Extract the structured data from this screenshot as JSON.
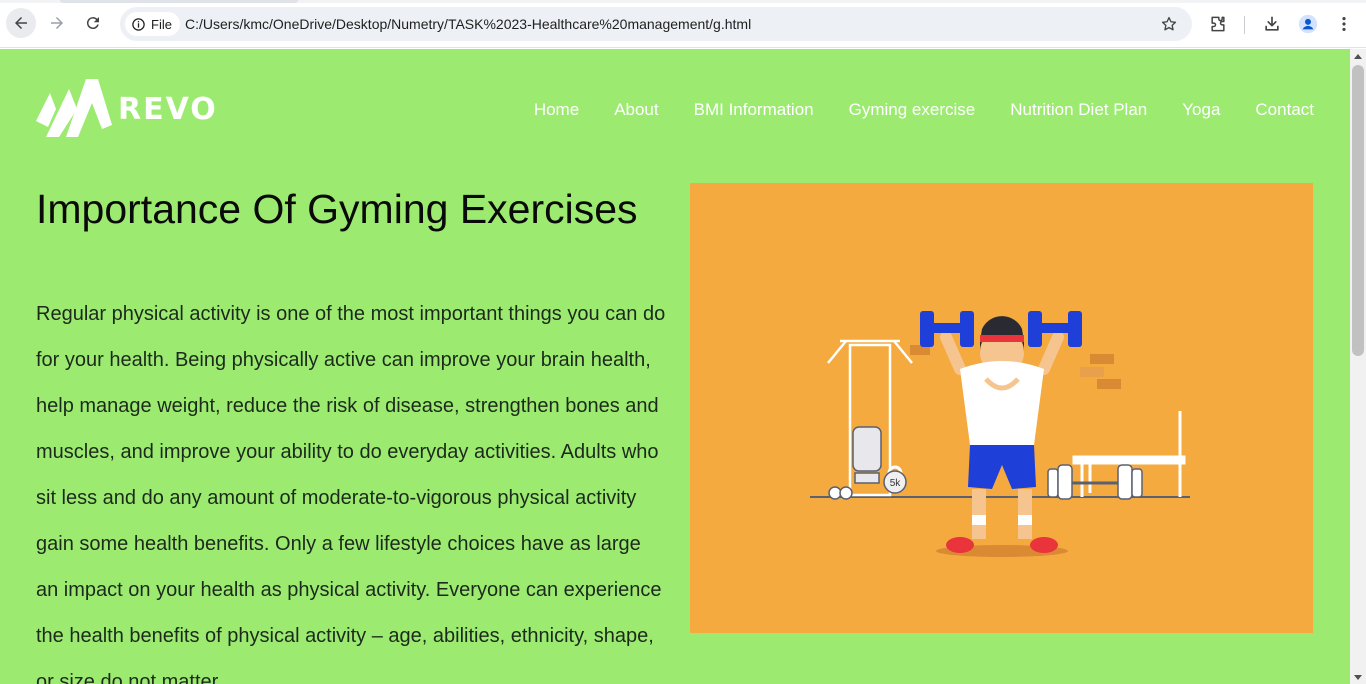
{
  "browser": {
    "chip_label": "File",
    "url": "C:/Users/kmc/OneDrive/Desktop/Numetry/TASK%2023-Healthcare%20management/g.html",
    "icons": [
      "back-arrow-icon",
      "forward-arrow-icon",
      "reload-icon",
      "info-icon",
      "star-icon",
      "extensions-icon",
      "download-icon",
      "profile-icon",
      "kebab-menu-icon"
    ]
  },
  "site": {
    "logo_text": "REVO",
    "nav": [
      "Home",
      "About",
      "BMI Information",
      "Gyming exercise",
      "Nutrition Diet Plan",
      "Yoga",
      "Contact"
    ]
  },
  "main": {
    "title": "Importance Of Gyming Exercises",
    "paragraph": "Regular physical activity is one of the most important things you can do for your health. Being physically active can improve your brain health, help manage weight, reduce the risk of disease, strengthen bones and muscles, and improve your ability to do everyday activities. Adults who sit less and do any amount of moderate-to-vigorous physical activity gain some health benefits. Only a few lifestyle choices have as large an impact on your health as physical activity. Everyone can experience the health benefits of physical activity – age, abilities, ethnicity, shape, or size do not matter.",
    "kettlebell_label": "5k"
  },
  "colors": {
    "page_bg": "#9ceb70",
    "hero_bg": "#f4aa3e",
    "dumbbell_blue": "#1e3fd8",
    "shoe_red": "#e8343a"
  }
}
